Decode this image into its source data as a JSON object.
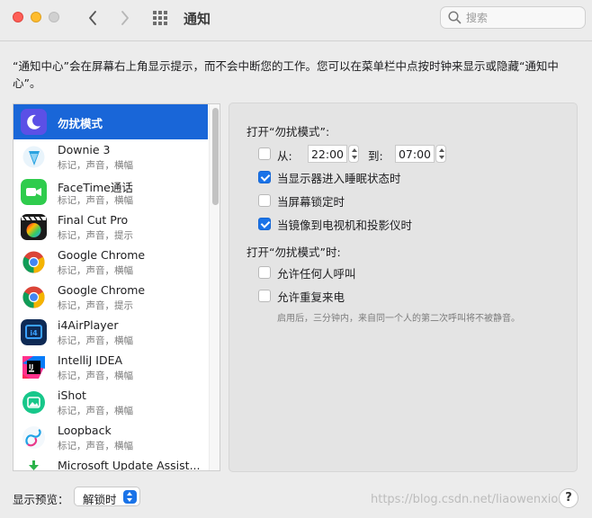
{
  "window": {
    "title": "通知",
    "search_placeholder": "搜索"
  },
  "description": "“通知中心”会在屏幕右上角显示提示，而不会中断您的工作。您可以在菜单栏中点按时钟来显示或隐藏“通知中心”。",
  "apps": [
    {
      "name": "勿扰模式",
      "subtitle": "",
      "icon": "moon-icon",
      "selected": true
    },
    {
      "name": "Downie 3",
      "subtitle": "标记，声音，横幅",
      "icon": "downie-app-icon"
    },
    {
      "name": "FaceTime通话",
      "subtitle": "标记，声音，横幅",
      "icon": "facetime-app-icon"
    },
    {
      "name": "Final Cut Pro",
      "subtitle": "标记，声音，提示",
      "icon": "final-cut-pro-app-icon"
    },
    {
      "name": "Google Chrome",
      "subtitle": "标记，声音，横幅",
      "icon": "chrome-app-icon"
    },
    {
      "name": "Google Chrome",
      "subtitle": "标记，声音，提示",
      "icon": "chrome-app-icon"
    },
    {
      "name": "i4AirPlayer",
      "subtitle": "标记，声音，横幅",
      "icon": "i4airplayer-app-icon"
    },
    {
      "name": "IntelliJ IDEA",
      "subtitle": "标记，声音，横幅",
      "icon": "intellij-app-icon"
    },
    {
      "name": "iShot",
      "subtitle": "标记，声音，横幅",
      "icon": "ishot-app-icon"
    },
    {
      "name": "Loopback",
      "subtitle": "标记，声音，横幅",
      "icon": "loopback-app-icon"
    },
    {
      "name": "Microsoft Update Assist...",
      "subtitle": "",
      "icon": "microsoft-update-app-icon"
    }
  ],
  "dnd": {
    "turn_on_label": "打开“勿扰模式”:",
    "from_label": "从:",
    "from_checked": false,
    "from_time": "22:00",
    "to_label": "到:",
    "to_time": "07:00",
    "options": [
      {
        "label": "当显示器进入睡眠状态时",
        "checked": true
      },
      {
        "label": "当屏幕锁定时",
        "checked": false
      },
      {
        "label": "当镜像到电视机和投影仪时",
        "checked": true
      }
    ],
    "when_on_label": "打开“勿扰模式”时:",
    "when_on_options": [
      {
        "label": "允许任何人呼叫",
        "checked": false
      },
      {
        "label": "允许重复来电",
        "checked": false
      }
    ],
    "hint": "启用后，三分钟内，来自同一个人的第二次呼叫将不被静音。"
  },
  "footer": {
    "preview_label": "显示预览：",
    "preview_value": "解锁时",
    "help_label": "?",
    "watermark": "https://blog.csdn.net/liaowenxiong"
  },
  "colors": {
    "selection": "#1966d8",
    "checkbox_checked": "#1a73e8"
  }
}
